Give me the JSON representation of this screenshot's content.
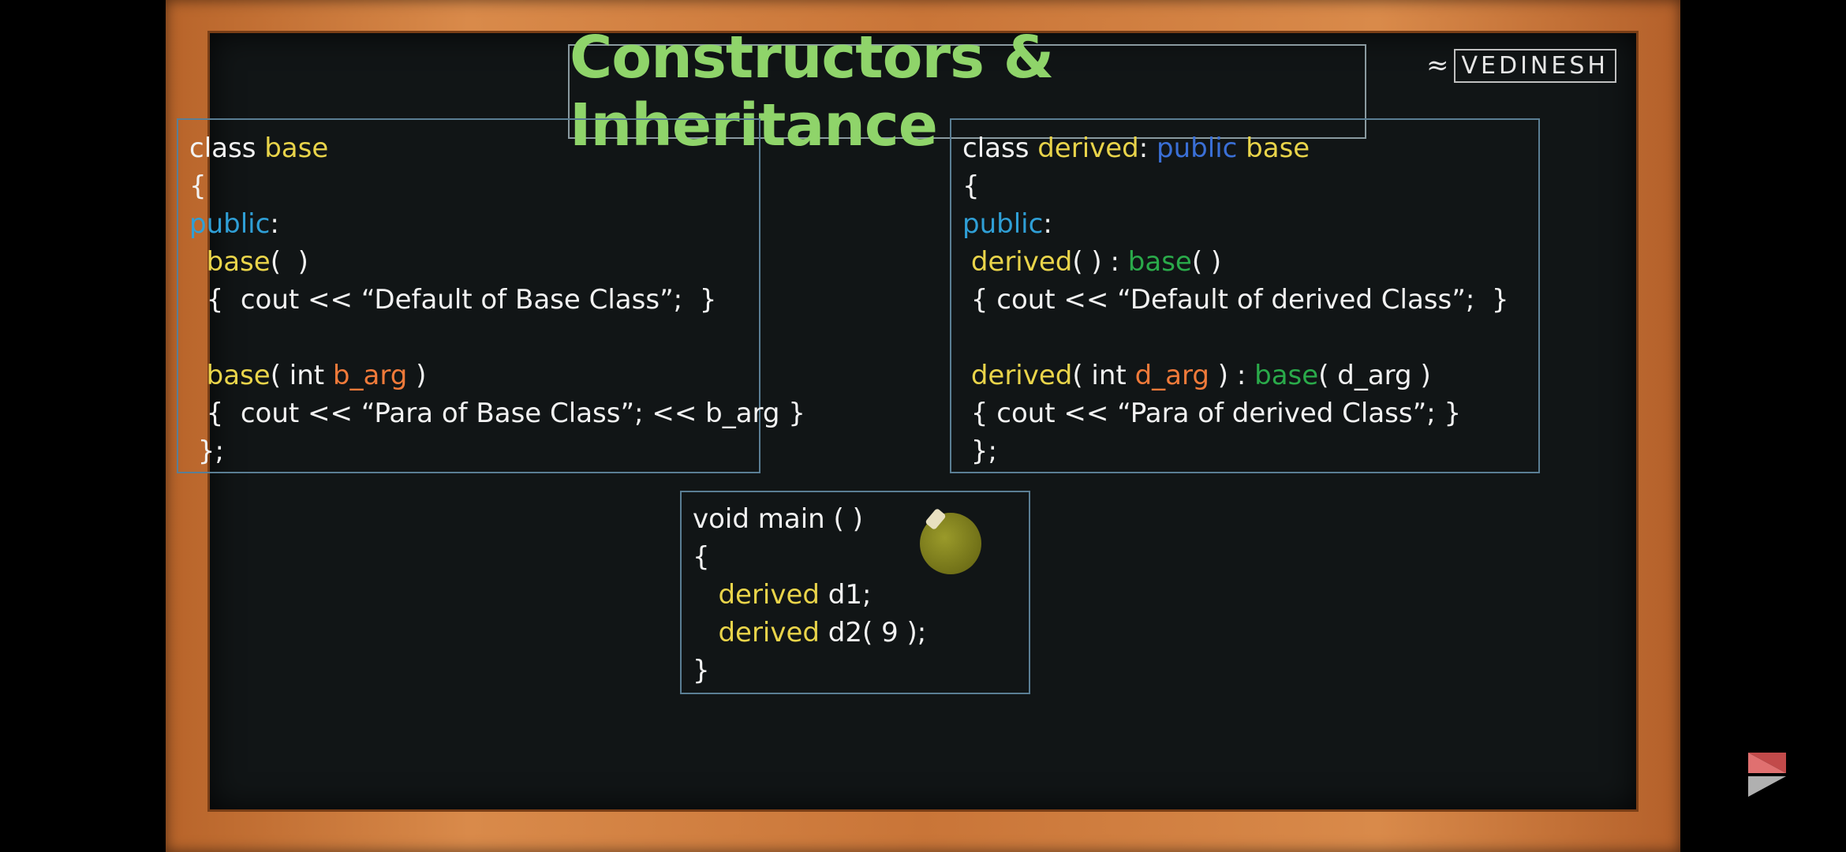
{
  "title": "Constructors & Inheritance",
  "brand": {
    "logo_text": "VEDINESH"
  },
  "base_class": {
    "lines": [
      [
        {
          "t": "class ",
          "c": ""
        },
        {
          "t": "base",
          "c": "kw-yellow"
        }
      ],
      [
        {
          "t": "{",
          "c": ""
        }
      ],
      [
        {
          "t": "public",
          "c": "kw-blue"
        },
        {
          "t": ":",
          "c": ""
        }
      ],
      [
        {
          "t": "  ",
          "c": ""
        },
        {
          "t": "base",
          "c": "kw-yellow"
        },
        {
          "t": "(  )",
          "c": ""
        }
      ],
      [
        {
          "t": "  {  cout << “Default of Base Class”;  }",
          "c": ""
        }
      ],
      [
        {
          "t": "",
          "c": ""
        }
      ],
      [
        {
          "t": "  ",
          "c": ""
        },
        {
          "t": "base",
          "c": "kw-yellow"
        },
        {
          "t": "( int ",
          "c": ""
        },
        {
          "t": "b_arg",
          "c": "kw-orange"
        },
        {
          "t": " )",
          "c": ""
        }
      ],
      [
        {
          "t": "  {  cout << “Para of Base Class”; << b_arg }",
          "c": ""
        }
      ],
      [
        {
          "t": " };",
          "c": ""
        }
      ]
    ]
  },
  "derived_class": {
    "lines": [
      [
        {
          "t": "class ",
          "c": ""
        },
        {
          "t": "derived",
          "c": "kw-yellow"
        },
        {
          "t": ": ",
          "c": ""
        },
        {
          "t": "public",
          "c": "kw-dblue"
        },
        {
          "t": " ",
          "c": ""
        },
        {
          "t": "base",
          "c": "kw-yellow"
        }
      ],
      [
        {
          "t": "{",
          "c": ""
        }
      ],
      [
        {
          "t": "public",
          "c": "kw-blue"
        },
        {
          "t": ":",
          "c": ""
        }
      ],
      [
        {
          "t": " ",
          "c": ""
        },
        {
          "t": "derived",
          "c": "kw-yellow"
        },
        {
          "t": "( ) : ",
          "c": ""
        },
        {
          "t": "base",
          "c": "kw-green"
        },
        {
          "t": "( )",
          "c": ""
        }
      ],
      [
        {
          "t": " { cout << “Default of derived Class”;  }",
          "c": ""
        }
      ],
      [
        {
          "t": "",
          "c": ""
        }
      ],
      [
        {
          "t": " ",
          "c": ""
        },
        {
          "t": "derived",
          "c": "kw-yellow"
        },
        {
          "t": "( int ",
          "c": ""
        },
        {
          "t": "d_arg",
          "c": "kw-orange"
        },
        {
          "t": " ) : ",
          "c": ""
        },
        {
          "t": "base",
          "c": "kw-green"
        },
        {
          "t": "( d_arg )",
          "c": ""
        }
      ],
      [
        {
          "t": " { cout << “Para of derived Class”; }",
          "c": ""
        }
      ],
      [
        {
          "t": " };",
          "c": ""
        }
      ]
    ]
  },
  "main_func": {
    "lines": [
      [
        {
          "t": "void main ( )",
          "c": ""
        }
      ],
      [
        {
          "t": "{",
          "c": ""
        }
      ],
      [
        {
          "t": "   ",
          "c": ""
        },
        {
          "t": "derived",
          "c": "kw-yellow"
        },
        {
          "t": " d1;",
          "c": ""
        }
      ],
      [
        {
          "t": "   ",
          "c": ""
        },
        {
          "t": "derived",
          "c": "kw-yellow"
        },
        {
          "t": " d2( 9 );",
          "c": ""
        }
      ],
      [
        {
          "t": "}",
          "c": ""
        }
      ]
    ]
  },
  "icons": {
    "pointer": "pen-cursor-icon",
    "nav": "share-arrow-icon"
  }
}
